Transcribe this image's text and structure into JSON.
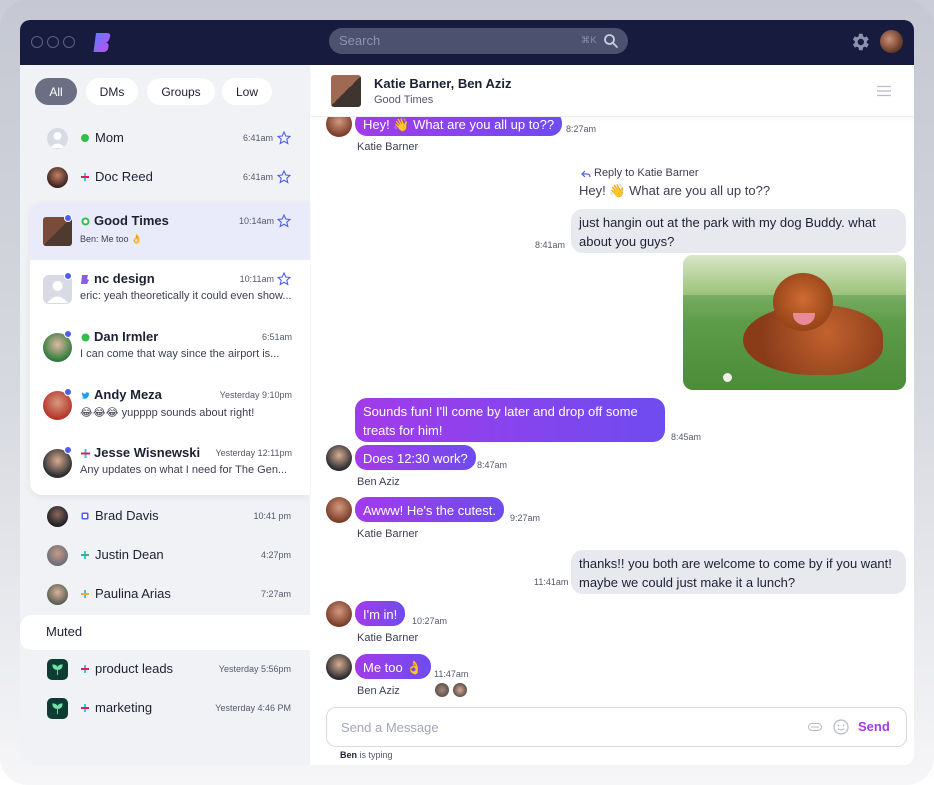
{
  "app": {
    "search_placeholder": "Search",
    "search_shortcut": "⌘K"
  },
  "filters": [
    "All",
    "DMs",
    "Groups",
    "Low"
  ],
  "conversations_top": [
    {
      "name": "Mom",
      "time": "6:41am",
      "source": "whatsapp"
    },
    {
      "name": "Doc Reed",
      "time": "6:41am",
      "source": "slack"
    }
  ],
  "conversations_card": [
    {
      "name": "Good Times",
      "time": "10:14am",
      "preview": "Ben: Me too 👌",
      "source": "whatsapp",
      "selected": true
    },
    {
      "name": "nc design",
      "time": "10:11am",
      "preview": "eric: yeah theoretically it could even show...",
      "source": "beeper"
    },
    {
      "name": "Dan Irmler",
      "time": "6:51am",
      "preview": "I can come that way since the airport is...",
      "source": "whatsapp"
    },
    {
      "name": "Andy Meza",
      "time": "Yesterday 9:10pm",
      "preview": "😂😂😂 yupppp sounds about right!",
      "source": "twitter"
    },
    {
      "name": "Jesse Wisnewski",
      "time": "Yesterday 12:11pm",
      "preview": "Any updates on what I need for The Gen...",
      "source": "slack"
    }
  ],
  "conversations_bottom": [
    {
      "name": "Brad Davis",
      "time": "10:41 pm",
      "source": "messenger"
    },
    {
      "name": "Justin Dean",
      "time": "4:27pm",
      "source": "slack"
    },
    {
      "name": "Paulina Arias",
      "time": "7:27am",
      "source": "slack"
    }
  ],
  "muted": {
    "label": "Muted",
    "items": [
      {
        "name": "product leads",
        "time": "Yesterday 5:56pm",
        "source": "slack"
      },
      {
        "name": "marketing",
        "time": "Yesterday 4:46 PM",
        "source": "slack"
      }
    ]
  },
  "chat": {
    "title": "Katie Barner, Ben Aziz",
    "subtitle": "Good Times",
    "messages": {
      "m1": {
        "text": "Hey! 👋 What are you all up to??",
        "time": "8:27am",
        "sender": "Katie Barner"
      },
      "reply_label": "Reply to Katie Barner",
      "reply_quote": "Hey! 👋 What are you all up to??",
      "m2": {
        "text": "just hangin out at the park with my dog Buddy. what about you guys?",
        "time": "8:41am"
      },
      "m3": {
        "text": "Sounds fun! I'll come by later and drop off some treats for him!",
        "time": "8:45am"
      },
      "m4": {
        "text": "Does 12:30 work?",
        "time": "8:47am",
        "sender": "Ben Aziz"
      },
      "m5": {
        "text": "Awww! He's the cutest.",
        "time": "9:27am",
        "sender": "Katie Barner"
      },
      "m6": {
        "text": "thanks!! you both are welcome to come by if you want! maybe we could just make it a lunch?",
        "time": "11:41am"
      },
      "m7": {
        "text": "I'm in!",
        "time": "10:27am",
        "sender": "Katie Barner"
      },
      "m8": {
        "text": "Me too 👌",
        "time": "11:47am",
        "sender": "Ben Aziz"
      }
    },
    "composer_placeholder": "Send a Message",
    "send_label": "Send",
    "typing_name": "Ben",
    "typing_suffix": " is typing"
  },
  "colors": {
    "accent_purple": "#a23bea",
    "accent_blue": "#4f5ee8",
    "titlebar": "#171c3e"
  }
}
